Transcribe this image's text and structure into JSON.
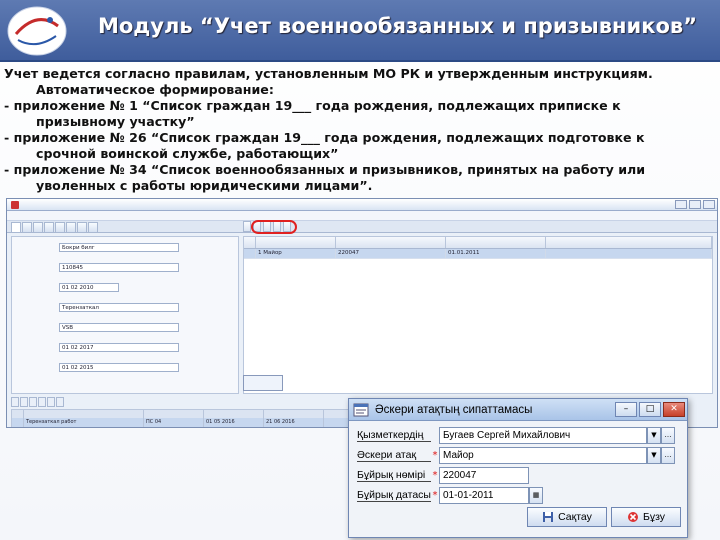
{
  "slide": {
    "title": "Модуль “Учет военнообязанных и призывников”",
    "paragraphs": [
      {
        "text": "Учет ведется согласно правилам, установленным МО РК и утвержденным инструкциям.",
        "indent": false
      },
      {
        "text": "Автоматическое формирование:",
        "indent": true
      },
      {
        "text": " - приложение № 1 “Список граждан 19___ года рождения, подлежащих приписке к",
        "indent": false
      },
      {
        "text": "призывному участку”",
        "indent": true
      },
      {
        "text": "- приложение № 26 “Список граждан 19___ года рождения, подлежащих подготовке к",
        "indent": false
      },
      {
        "text": "срочной воинской службе, работающих”",
        "indent": true
      },
      {
        "text": "- приложение № 34 “Список военнообязанных и призывников, принятых на работу или",
        "indent": false
      },
      {
        "text": "уволенных с работы юридическими лицами”.",
        "indent": true
      }
    ]
  },
  "app": {
    "left_form": {
      "fields": [
        {
          "label": "",
          "value": "Бокри билг"
        },
        {
          "label": "",
          "value": "110845"
        },
        {
          "label": "",
          "value": "01 02 2010"
        },
        {
          "label": "",
          "value": "Терензаткал"
        },
        {
          "label": "",
          "value": "VSB"
        },
        {
          "label": "",
          "value": "01 02 2017"
        },
        {
          "label": "",
          "value": "01 02 2015"
        }
      ]
    },
    "grid": {
      "row1": [
        "1 Майор",
        "220047",
        "01.01.2011"
      ]
    },
    "bottom_grid": {
      "row1": [
        "Терензаткал работ",
        "ПС 04",
        "01 05 2016",
        "21 06 2016"
      ]
    }
  },
  "dialog": {
    "title": "Әскери атақтың сипаттамасы",
    "fields": [
      {
        "label": "Қызметкердің",
        "value": "Бугаев Сергей Михайлович",
        "required": false,
        "dropdown": true
      },
      {
        "label": "Әскери атақ",
        "value": "Майор",
        "required": true,
        "dropdown": true
      },
      {
        "label": "Бұйрық нөмірі",
        "value": "220047",
        "required": true,
        "dropdown": false
      },
      {
        "label": "Бұйрық датасы",
        "value": "01-01-2011",
        "required": true,
        "dropdown": true
      }
    ],
    "save_label": "Сақтау",
    "cancel_label": "Бұзу",
    "minimize_label": "–",
    "maximize_label": "□",
    "close_label": "✕"
  }
}
